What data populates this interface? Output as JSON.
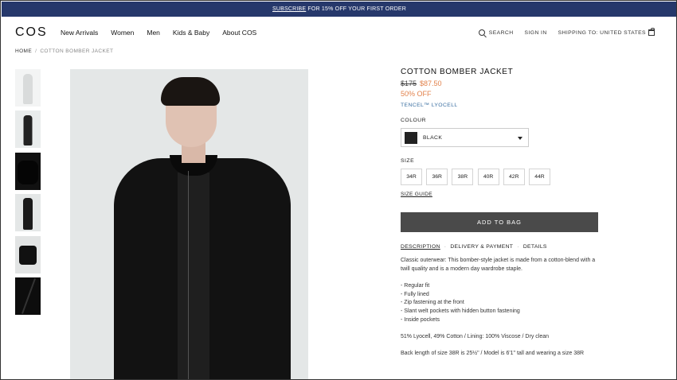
{
  "promo": {
    "link": "SUBSCRIBE",
    "text": " FOR 15% OFF YOUR FIRST ORDER"
  },
  "nav": {
    "logo": "COS",
    "links": [
      "New Arrivals",
      "Women",
      "Men",
      "Kids & Baby",
      "About COS"
    ],
    "search": "SEARCH",
    "signin": "SIGN IN",
    "shipping": "SHIPPING TO: UNITED STATES"
  },
  "breadcrumb": {
    "home": "HOME",
    "sep": "/",
    "current": "COTTON BOMBER JACKET"
  },
  "product": {
    "title": "COTTON BOMBER JACKET",
    "old_price": "$175",
    "new_price": "$87.50",
    "discount": "50% OFF",
    "material": "TENCEL™ LYOCELL",
    "colour_label": "COLOUR",
    "colour_value": "BLACK",
    "swatch_color": "#222222",
    "size_label": "SIZE",
    "sizes": [
      "34R",
      "36R",
      "38R",
      "40R",
      "42R",
      "44R"
    ],
    "size_guide": "SIZE GUIDE",
    "add_to_bag": "ADD TO BAG"
  },
  "tabs": [
    "DESCRIPTION",
    "DELIVERY & PAYMENT",
    "DETAILS"
  ],
  "description": {
    "intro": "Classic outerwear: This bomber-style jacket is made from a cotton-blend with a twill quality and is a modern day wardrobe staple.",
    "bullets": [
      "- Regular fit",
      "- Fully lined",
      "- Zip fastening at the front",
      "- Slant welt pockets with hidden button fastening",
      "- Inside pockets"
    ],
    "composition": "51% Lyocell, 49% Cotton / Lining: 100% Viscose / Dry clean",
    "fit": "Back length of size 38R is 25½\" / Model is 6'1\" tall and wearing a size 38R"
  },
  "colors": {
    "promo_bar": "#26386b",
    "sale": "#e2824c",
    "material_link": "#3a6fa1",
    "button": "#4a4a4a"
  }
}
